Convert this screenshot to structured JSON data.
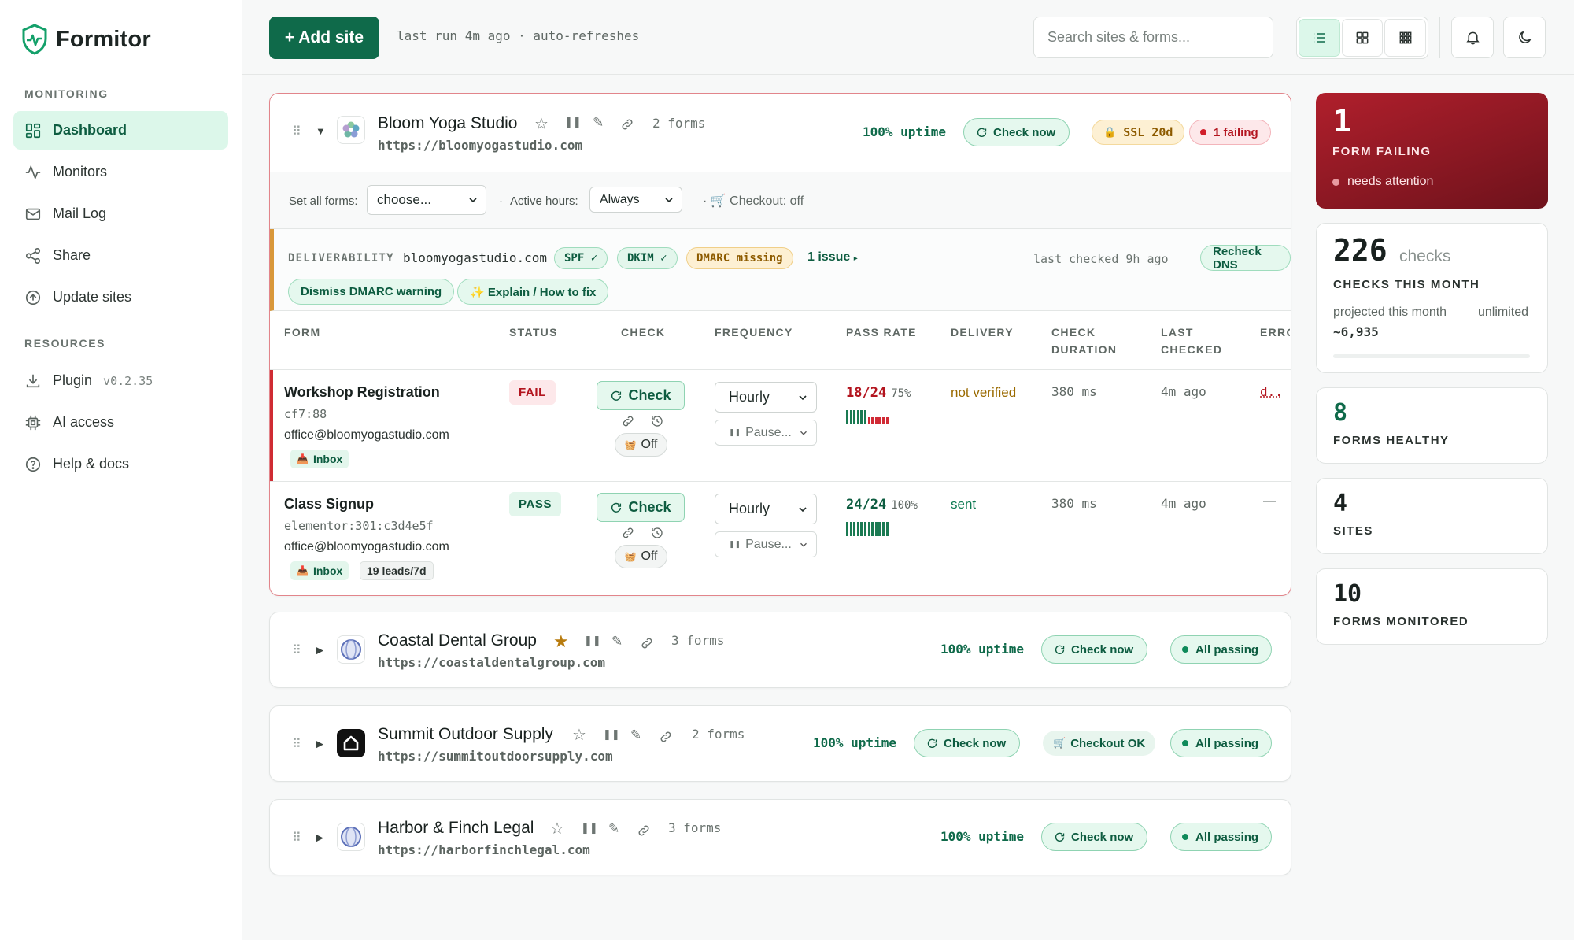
{
  "brand": {
    "name": "Formitor"
  },
  "sidebar": {
    "monitoring_label": "MONITORING",
    "resources_label": "RESOURCES",
    "items": [
      {
        "label": "Dashboard",
        "icon": "dashboard-icon",
        "active": true
      },
      {
        "label": "Monitors",
        "icon": "activity-icon"
      },
      {
        "label": "Mail Log",
        "icon": "mail-icon"
      },
      {
        "label": "Share",
        "icon": "share-icon"
      },
      {
        "label": "Update sites",
        "icon": "upload-icon"
      },
      {
        "label": "Plugin",
        "icon": "download-icon",
        "version": "v0.2.35"
      },
      {
        "label": "AI access",
        "icon": "chip-icon"
      },
      {
        "label": "Help & docs",
        "icon": "help-icon"
      }
    ]
  },
  "toolbar": {
    "add_label": "+ Add site",
    "last_run": "last run 4m ago · auto-refreshes",
    "search_placeholder": "Search sites & forms..."
  },
  "sites": [
    {
      "name": "Bloom Yoga Studio",
      "url": "https://bloomyogastudio.com",
      "forms_count": "2 forms",
      "uptime": "100% uptime",
      "check_now": "Check now",
      "ssl": "SSL 20d",
      "status": "1 failing",
      "starred": false,
      "expanded": true,
      "set_all": {
        "label": "Set all forms:",
        "value": "choose...",
        "active_label": "Active hours:",
        "active_value": "Always",
        "checkout": "Checkout: off"
      },
      "deliverability": {
        "label": "DELIVERABILITY",
        "domain": "bloomyogastudio.com",
        "spf": "SPF ✓",
        "dkim": "DKIM ✓",
        "dmarc": "DMARC missing",
        "issues": "1 issue",
        "last_checked": "last checked 9h ago",
        "recheck": "Recheck DNS",
        "dismiss": "Dismiss DMARC warning",
        "explain": "✨ Explain / How to fix"
      },
      "columns": [
        "FORM",
        "STATUS",
        "CHECK",
        "FREQUENCY",
        "PASS RATE",
        "DELIVERY",
        "CHECK DURATION",
        "LAST CHECKED",
        "ERRO"
      ],
      "forms": [
        {
          "name": "Workshop Registration",
          "id": "cf7:88",
          "email": "office@bloomyogastudio.com",
          "inbox": "Inbox",
          "leads": "",
          "status": "FAIL",
          "check": "Check",
          "checkout": "Off",
          "frequency": "Hourly",
          "pause": "Pause...",
          "pass_rate": "18/24",
          "pass_pct": "75%",
          "history": [
            1,
            1,
            1,
            1,
            1,
            1,
            0,
            0,
            0,
            0,
            0,
            0
          ],
          "delivery": "not verified",
          "duration": "380 ms",
          "last_checked": "4m ago",
          "error": "d.."
        },
        {
          "name": "Class Signup",
          "id": "elementor:301:c3d4e5f",
          "email": "office@bloomyogastudio.com",
          "inbox": "Inbox",
          "leads": "19 leads/7d",
          "status": "PASS",
          "check": "Check",
          "checkout": "Off",
          "frequency": "Hourly",
          "pause": "Pause...",
          "pass_rate": "24/24",
          "pass_pct": "100%",
          "history": [
            1,
            1,
            1,
            1,
            1,
            1,
            1,
            1,
            1,
            1,
            1,
            1
          ],
          "delivery": "sent",
          "duration": "380 ms",
          "last_checked": "4m ago",
          "error": "—"
        }
      ]
    },
    {
      "name": "Coastal Dental Group",
      "url": "https://coastaldentalgroup.com",
      "forms_count": "3 forms",
      "uptime": "100% uptime",
      "check_now": "Check now",
      "status": "All passing",
      "starred": true
    },
    {
      "name": "Summit Outdoor Supply",
      "url": "https://summitoutdoorsupply.com",
      "forms_count": "2 forms",
      "uptime": "100% uptime",
      "check_now": "Check now",
      "checkout": "Checkout OK",
      "status": "All passing",
      "starred": false
    },
    {
      "name": "Harbor & Finch Legal",
      "url": "https://harborfinchlegal.com",
      "forms_count": "3 forms",
      "uptime": "100% uptime",
      "check_now": "Check now",
      "status": "All passing",
      "starred": false
    }
  ],
  "stats": {
    "failing": {
      "value": "1",
      "label": "FORM FAILING",
      "sub": "needs attention"
    },
    "checks": {
      "value": "226",
      "unit": "checks",
      "label": "CHECKS THIS MONTH",
      "projected_label": "projected this month",
      "projected_value": "~6,935",
      "limit": "unlimited"
    },
    "healthy": {
      "value": "8",
      "label": "FORMS HEALTHY"
    },
    "sites": {
      "value": "4",
      "label": "SITES"
    },
    "forms": {
      "value": "10",
      "label": "FORMS MONITORED"
    }
  },
  "colors": {
    "brand": "#0f6a4a",
    "fail": "#b3151f",
    "warn": "#d9983a",
    "danger_card": "#9b1c27"
  }
}
